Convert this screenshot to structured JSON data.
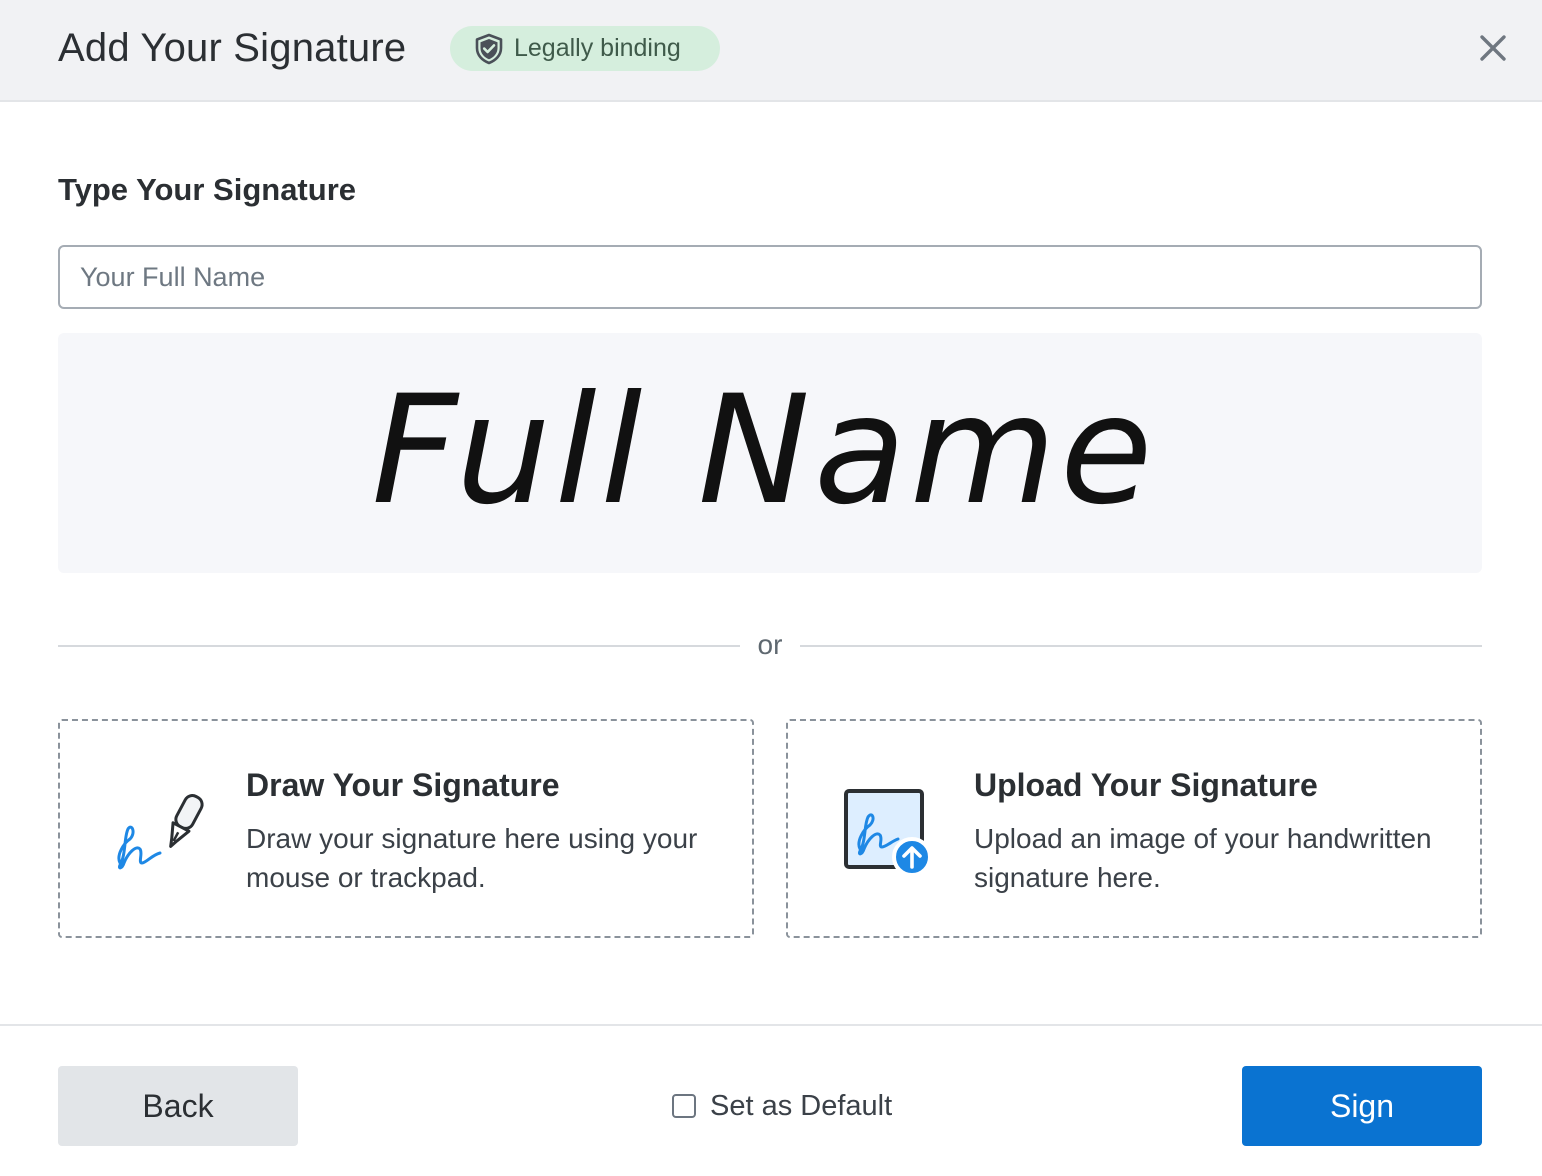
{
  "header": {
    "title": "Add Your Signature",
    "badge": {
      "label": "Legally binding",
      "icon": "shield-check-icon"
    },
    "close_icon": "close-icon"
  },
  "type_section": {
    "title": "Type Your Signature",
    "input": {
      "value": "",
      "placeholder": "Your Full Name"
    },
    "preview_text": "Full Name"
  },
  "divider": {
    "label": "or"
  },
  "options": [
    {
      "title": "Draw Your Signature",
      "description": "Draw your signature here using your mouse or trackpad.",
      "icon": "pen-signature-icon"
    },
    {
      "title": "Upload Your Signature",
      "description": "Upload an image of your handwritten signature here.",
      "icon": "upload-signature-icon"
    }
  ],
  "footer": {
    "back_label": "Back",
    "default_label": "Set as Default",
    "default_checked": false,
    "sign_label": "Sign"
  },
  "colors": {
    "primary": "#0a73d1",
    "badge_bg": "#d5eedd",
    "header_bg": "#f1f2f4",
    "icon_blue": "#1e88e5"
  }
}
